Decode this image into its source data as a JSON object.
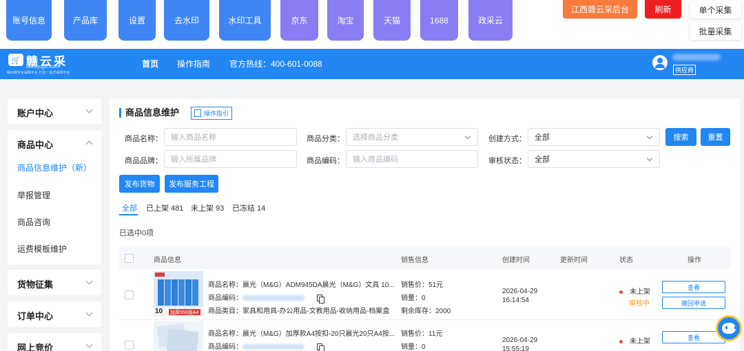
{
  "toolbar": {
    "buttons": [
      {
        "label": "账号信息",
        "color": "#3f86f4"
      },
      {
        "label": "产品库",
        "color": "#3f86f4"
      },
      {
        "label": "设置",
        "color": "#3f86f4"
      },
      {
        "label": "去水印",
        "color": "#3f86f4"
      },
      {
        "label": "水印工具",
        "color": "#3f86f4"
      },
      {
        "label": "京东",
        "color": "#8a7cf3"
      },
      {
        "label": "淘宝",
        "color": "#8a7cf3"
      },
      {
        "label": "天猫",
        "color": "#8a7cf3"
      },
      {
        "label": "1688",
        "color": "#8a7cf3"
      },
      {
        "label": "政采云",
        "color": "#8a7cf3"
      }
    ],
    "backend_label": "江西赣云采后台",
    "refresh_label": "刷新",
    "single_collect_label": "单个采集",
    "batch_collect_label": "批量采集"
  },
  "header": {
    "logo_name": "赣云采",
    "logo_icon": "cart-icon",
    "logo_url": "www.jxgyc.com",
    "logo_slogan": "赣州数字化采购平台 打造一站式采购平台",
    "nav_home": "首页",
    "nav_guide": "操作指南",
    "hotline": "官方热线：400-601-0088",
    "role_tag": "供应商",
    "accent": "#2286f3"
  },
  "sidebar": {
    "account_center": "账户中心",
    "product_center": "商品中心",
    "product_links": [
      "商品信息维护（新）",
      "举报管理",
      "商品咨询",
      "运费模板维护"
    ],
    "goods_collection": "货物征集",
    "order_center": "订单中心",
    "online_bidding": "网上竞价"
  },
  "main": {
    "title": "商品信息维护",
    "guide_button": "操作指引",
    "filters": {
      "name_label": "商品名称：",
      "name_placeholder": "输入商品名称",
      "category_label": "商品分类：",
      "category_placeholder": "选择商品分类",
      "create_label": "创建方式：",
      "create_value": "全部",
      "brand_label": "商品品牌：",
      "brand_placeholder": "输入所属品牌",
      "code_label": "商品编码：",
      "code_placeholder": "输入商品编码",
      "audit_label": "审核状态：",
      "audit_value": "全部",
      "search_button": "搜索",
      "reset_button": "重置"
    },
    "publish_goods": "发布货物",
    "publish_service": "发布服务工程",
    "tabs": [
      "全部",
      "已上架 481",
      "未上架 93",
      "已冻结 14"
    ],
    "selected_count": "已选中0项",
    "columns": [
      "商品信息",
      "销售信息",
      "创建时间",
      "更新时间",
      "状态",
      "操作"
    ],
    "rows": [
      {
        "name": "商品名称：晨光（M&G）ADM945DA晨光（M&G）文具 10...",
        "code_label": "商品编码：",
        "category": "商品类目：家具和用具-办公用品-文教用品-收纳用品-档案盒",
        "price": "销售价：51元",
        "sales": "销量：0",
        "stock": "剩余库存：2000",
        "created_date": "2026-04-29",
        "created_time": "16:14:54",
        "status": "未上架",
        "audit": "审核中",
        "action_view": "查看",
        "action_withdraw": "撤回申请"
      },
      {
        "name": "商品名称：晨光（M&G）加厚款A4按扣-20只晨光20只A4按...",
        "code_label": "商品编码：",
        "price": "销售价：11元",
        "sales": "销量：0",
        "created_date": "2026-04-29",
        "created_time": "15:55:19",
        "status": "未上架",
        "action_view": "查看"
      }
    ],
    "thumb1_badge": "10",
    "thumb1_text": "加厚550张A4"
  }
}
